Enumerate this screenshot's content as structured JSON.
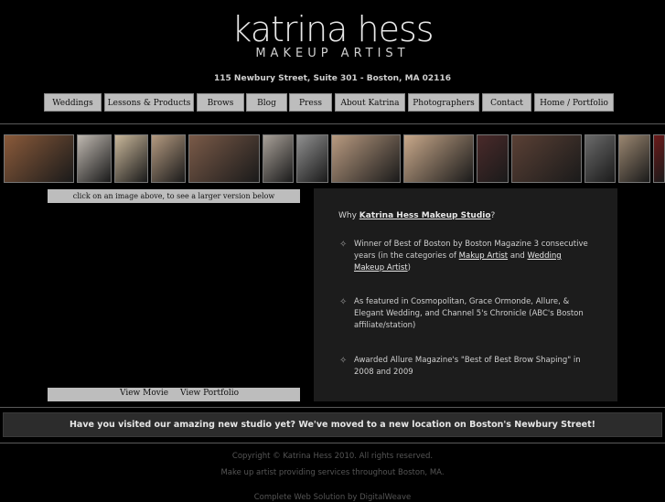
{
  "brand": {
    "name": "katrina hess",
    "tagline": "MAKEUP ARTIST"
  },
  "address": "115 Newbury Street, Suite 301 - Boston, MA 02116",
  "nav": [
    {
      "label": "Weddings"
    },
    {
      "label": "Lessons & Products"
    },
    {
      "label": "Brows"
    },
    {
      "label": "Blog"
    },
    {
      "label": "Press"
    },
    {
      "label": "About Katrina"
    },
    {
      "label": "Photographers"
    },
    {
      "label": "Contact"
    },
    {
      "label": "Home / Portfolio"
    }
  ],
  "gallery": {
    "thumbnails": [
      {
        "icon": "studio-photo",
        "color": "#8a5a3a"
      },
      {
        "icon": "bride-photo",
        "color": "#bfb8b0"
      },
      {
        "icon": "bride-photo",
        "color": "#c9b79a"
      },
      {
        "icon": "bride-photo",
        "color": "#b49a80"
      },
      {
        "icon": "bride-portrait-photo",
        "color": "#7a5a48"
      },
      {
        "icon": "makeup-session-photo",
        "color": "#a8a098"
      },
      {
        "icon": "makeup-session-photo",
        "color": "#8f8f8f"
      },
      {
        "icon": "makeup-session-photo",
        "color": "#b89a80"
      },
      {
        "icon": "makeup-session-photo",
        "color": "#c8a88a"
      },
      {
        "icon": "portrait-photo",
        "color": "#4a2a2a"
      },
      {
        "icon": "group-photo",
        "color": "#5a4035"
      },
      {
        "icon": "portrait-photo",
        "color": "#6a6a6a"
      },
      {
        "icon": "portrait-photo",
        "color": "#9a8670"
      },
      {
        "icon": "portrait-photo",
        "color": "#6a1a1a"
      }
    ],
    "hint": "click on an image above, to see a larger version below",
    "view_movie": "View Movie",
    "view_portfolio": "View Portfolio"
  },
  "panel": {
    "why_prefix": "Why ",
    "studio_link": "Katrina Hess Makeup Studio",
    "why_suffix": "?",
    "bullet1_text": "Winner of Best of Boston by Boston Magazine 3 consecutive years (in the categories of ",
    "bullet1_link1": "Makup Artist",
    "bullet1_and": " and ",
    "bullet1_link2": "Wedding Makeup Artist",
    "bullet1_end": ")",
    "bullet2": "As featured in Cosmopolitan, Grace Ormonde, Allure, & Elegant Wedding, and Channel 5's Chronicle (ABC's Boston affiliate/station)",
    "bullet3": "Awarded Allure Magazine's \"Best of Best Brow Shaping\" in 2008 and 2009"
  },
  "banner": "Have you visited our amazing new studio yet?  We've moved to a new location on Boston's Newbury Street!",
  "footer": {
    "copyright": "Copyright © Katrina Hess 2010. All rights reserved.",
    "services": "Make up artist providing services throughout Boston, MA.",
    "credit": "Complete Web Solution by DigitalWeave"
  }
}
